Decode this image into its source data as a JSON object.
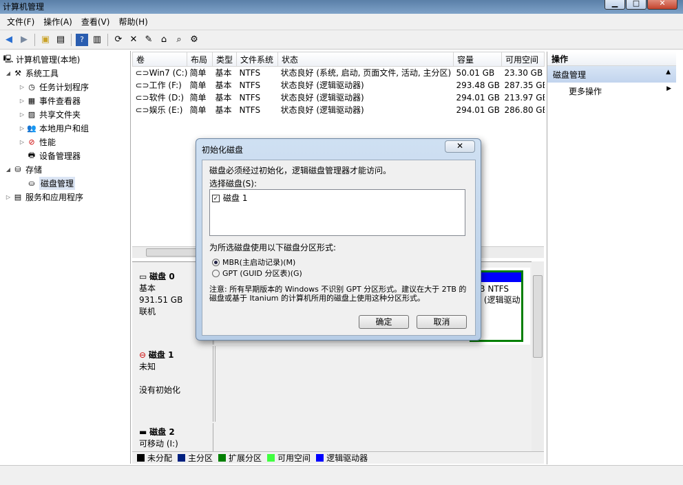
{
  "window": {
    "title": "计算机管理",
    "min": "▁",
    "max": "□",
    "close": "✕"
  },
  "menu": [
    "文件(F)",
    "操作(A)",
    "查看(V)",
    "帮助(H)"
  ],
  "tree": {
    "root": "计算机管理(本地)",
    "system_tools": "系统工具",
    "task_scheduler": "任务计划程序",
    "event_viewer": "事件查看器",
    "shared_folders": "共享文件夹",
    "local_users": "本地用户和组",
    "performance": "性能",
    "device_manager": "设备管理器",
    "storage": "存储",
    "disk_management": "磁盘管理",
    "services": "服务和应用程序"
  },
  "volumes": {
    "headers": [
      "卷",
      "布局",
      "类型",
      "文件系统",
      "状态",
      "容量",
      "可用空间"
    ],
    "rows": [
      [
        "Win7 (C:)",
        "简单",
        "基本",
        "NTFS",
        "状态良好 (系统, 启动, 页面文件, 活动, 主分区)",
        "50.01 GB",
        "23.30 GB"
      ],
      [
        "工作 (F:)",
        "简单",
        "基本",
        "NTFS",
        "状态良好 (逻辑驱动器)",
        "293.48 GB",
        "287.35 GB"
      ],
      [
        "软件 (D:)",
        "简单",
        "基本",
        "NTFS",
        "状态良好 (逻辑驱动器)",
        "294.01 GB",
        "213.97 GB"
      ],
      [
        "娱乐 (E:)",
        "简单",
        "基本",
        "NTFS",
        "状态良好 (逻辑驱动器)",
        "294.01 GB",
        "286.80 GB"
      ]
    ]
  },
  "disks": [
    {
      "name": "磁盘 0",
      "type": "基本",
      "size": "931.51 GB",
      "status": "联机",
      "partition_size": "GB NTFS",
      "partition_status": "好 (逻辑驱动"
    },
    {
      "name": "磁盘 1",
      "type": "未知",
      "status": "没有初始化"
    },
    {
      "name": "磁盘 2",
      "type": "可移动 (I:)"
    }
  ],
  "legend": [
    {
      "label": "未分配",
      "color": "#000000"
    },
    {
      "label": "主分区",
      "color": "#00207f"
    },
    {
      "label": "扩展分区",
      "color": "#007f00"
    },
    {
      "label": "可用空间",
      "color": "#40ff40"
    },
    {
      "label": "逻辑驱动器",
      "color": "#0000ff"
    }
  ],
  "actions": {
    "header": "操作",
    "group": "磁盘管理",
    "more": "更多操作"
  },
  "dialog": {
    "title": "初始化磁盘",
    "close": "✕",
    "message": "磁盘必须经过初始化，逻辑磁盘管理器才能访问。",
    "select_label": "选择磁盘(S):",
    "disk_item": "磁盘 1",
    "partition_label": "为所选磁盘使用以下磁盘分区形式:",
    "mbr": "MBR(主启动记录)(M)",
    "gpt": "GPT (GUID 分区表)(G)",
    "note": "注意: 所有早期版本的 Windows 不识别 GPT 分区形式。建议在大于 2TB 的磁盘或基于 Itanium 的计算机所用的磁盘上使用这种分区形式。",
    "ok": "确定",
    "cancel": "取消"
  }
}
